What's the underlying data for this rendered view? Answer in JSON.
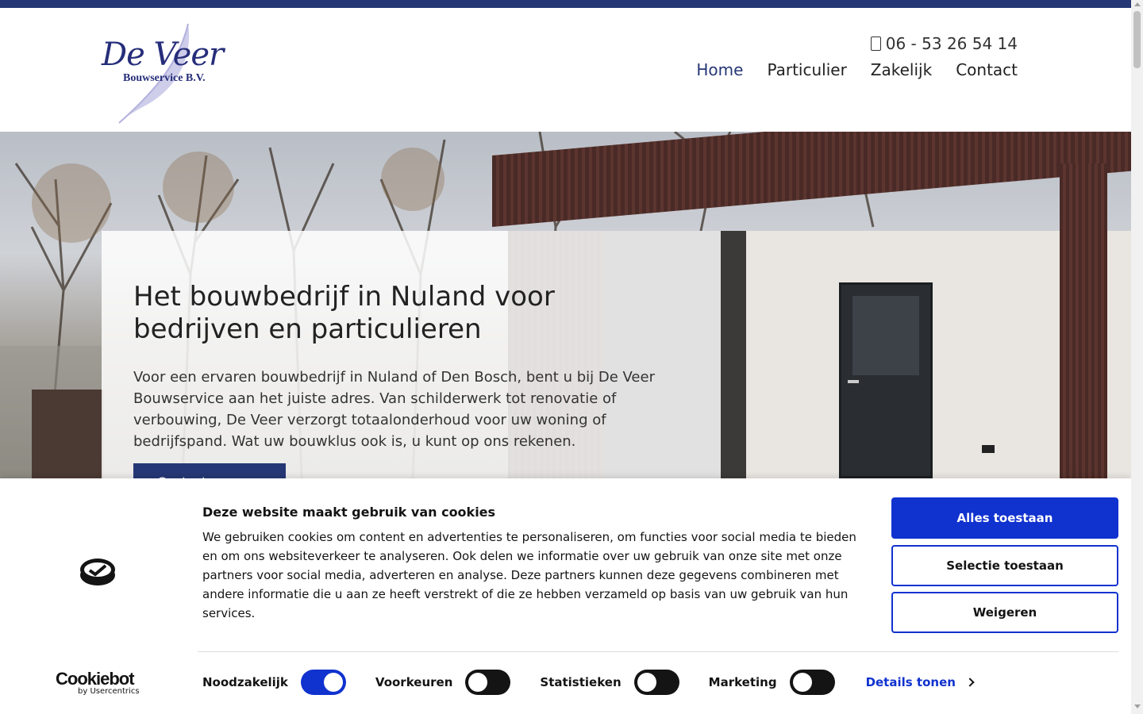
{
  "header": {
    "logo": {
      "brand": "De Veer",
      "subtitle": "Bouwservice B.V."
    },
    "phone": {
      "icon": "phone-icon",
      "number": "06 - 53 26 54 14"
    },
    "nav": [
      {
        "label": "Home",
        "active": true
      },
      {
        "label": "Particulier",
        "active": false
      },
      {
        "label": "Zakelijk",
        "active": false
      },
      {
        "label": "Contact",
        "active": false
      }
    ]
  },
  "hero": {
    "title": "Het bouwbedrijf in Nuland voor bedrijven en particulieren",
    "text": "Voor een ervaren bouwbedrijf in Nuland of Den Bosch, bent u bij De Veer Bouwservice aan het juiste adres. Van schilderwerk tot renovatie of verbouwing, De Veer verzorgt totaalonderhoud voor uw woning of bedrijfspand. Wat uw bouwklus ook is, u kunt op ons rekenen.",
    "button_label": "Contact"
  },
  "cookie": {
    "title": "Deze website maakt gebruik van cookies",
    "text": "We gebruiken cookies om content en advertenties te personaliseren, om functies voor social media te bieden en om ons websiteverkeer te analyseren. Ook delen we informatie over uw gebruik van onze site met onze partners voor social media, adverteren en analyse. Deze partners kunnen deze gegevens combineren met andere informatie die u aan ze heeft verstrekt of die ze hebben verzameld op basis van uw gebruik van hun services.",
    "buttons": {
      "allow_all": "Alles toestaan",
      "allow_selection": "Selectie toestaan",
      "deny": "Weigeren"
    },
    "toggles": [
      {
        "label": "Noodzakelijk",
        "on": true
      },
      {
        "label": "Voorkeuren",
        "on": false
      },
      {
        "label": "Statistieken",
        "on": false
      },
      {
        "label": "Marketing",
        "on": false
      }
    ],
    "details_label": "Details tonen",
    "brand": {
      "name": "Cookiebot",
      "by": "by Usercentrics"
    }
  },
  "colors": {
    "navy": "#263775",
    "cookie_blue": "#1032cf"
  }
}
